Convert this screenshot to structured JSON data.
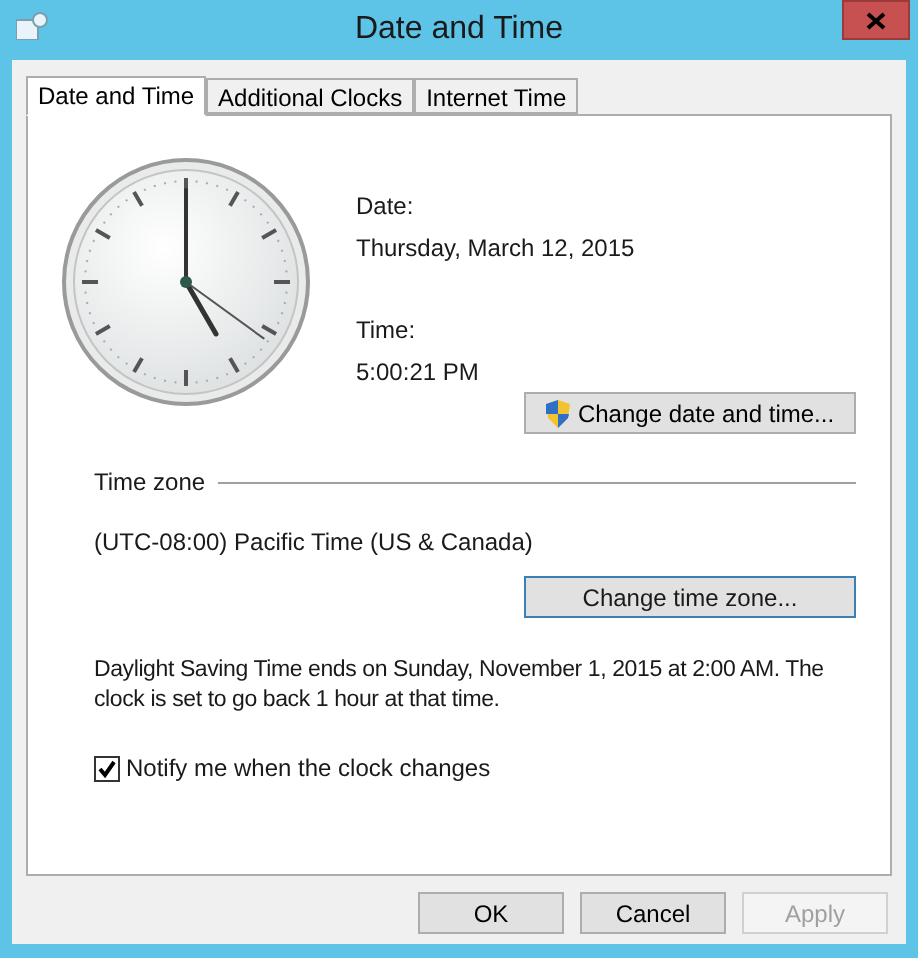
{
  "window": {
    "title": "Date and Time"
  },
  "tabs": [
    {
      "label": "Date and Time",
      "selected": true
    },
    {
      "label": "Additional Clocks",
      "selected": false
    },
    {
      "label": "Internet Time",
      "selected": false
    }
  ],
  "date": {
    "label": "Date:",
    "value": "Thursday, March 12, 2015"
  },
  "time": {
    "label": "Time:",
    "value": "5:00:21 PM"
  },
  "change_datetime_button": {
    "label": "Change date and time..."
  },
  "time_zone": {
    "heading": "Time zone",
    "value": "(UTC-08:00) Pacific Time (US & Canada)",
    "button": {
      "label": "Change time zone...",
      "focused": true
    }
  },
  "dst_note": "Daylight Saving Time ends on Sunday, November 1, 2015 at 2:00 AM. The clock is set to go back 1 hour at that time.",
  "notify": {
    "label": "Notify me when the clock changes",
    "checked": true
  },
  "buttons": [
    {
      "label": "OK",
      "disabled": false
    },
    {
      "label": "Cancel",
      "disabled": false
    },
    {
      "label": "Apply",
      "disabled": true
    }
  ]
}
